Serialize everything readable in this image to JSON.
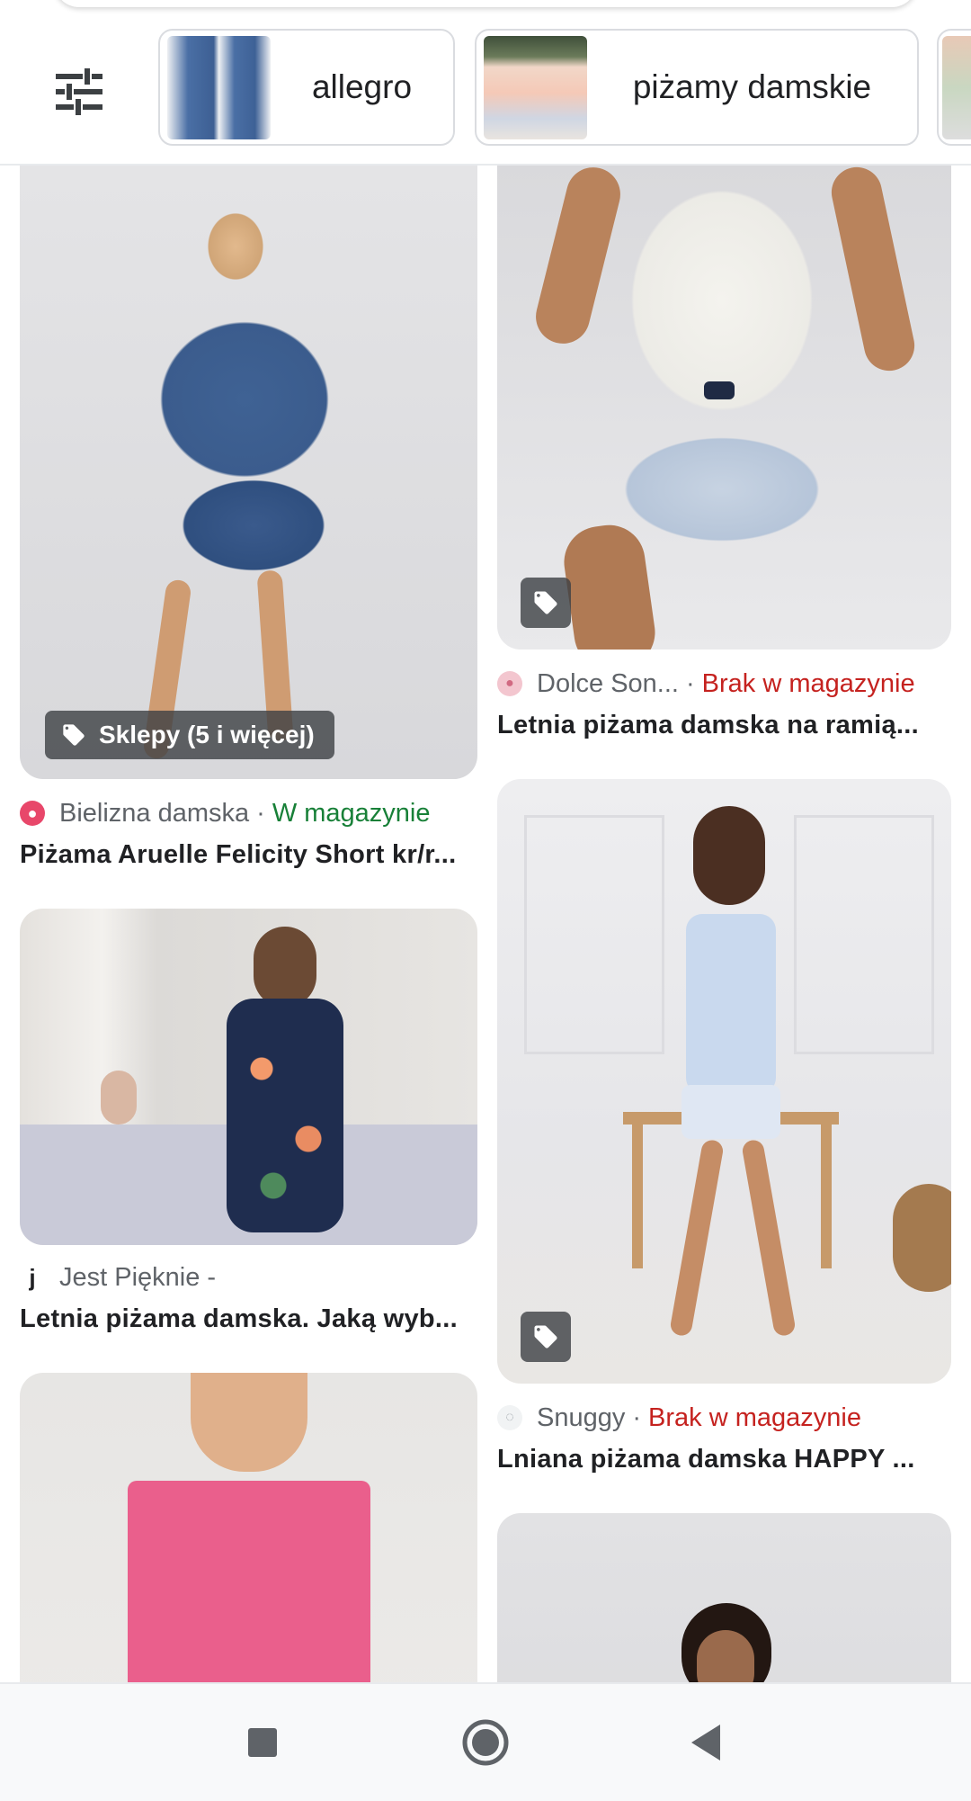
{
  "chips": [
    {
      "label": "allegro"
    },
    {
      "label": "piżamy damskie"
    }
  ],
  "cards": [
    {
      "badge": "Sklepy (5 i więcej)",
      "source": "Bielizna damska",
      "stock": "W magazynie",
      "title": "Piżama Aruelle Felicity Short kr/r..."
    },
    {
      "source": "Dolce Son...",
      "stock": "Brak w magazynie",
      "title": "Letnia piżama damska na ramią..."
    },
    {
      "favicon_letter": "j",
      "source": "Jest Pięknie -",
      "title": "Letnia piżama damska. Jaką wyb..."
    },
    {
      "source": "Snuggy",
      "stock": "Brak w magazynie",
      "title": "Lniana piżama damska HAPPY ..."
    }
  ],
  "separator": "·",
  "colors": {
    "in_stock": "#188038",
    "out_of_stock": "#c5221f"
  }
}
